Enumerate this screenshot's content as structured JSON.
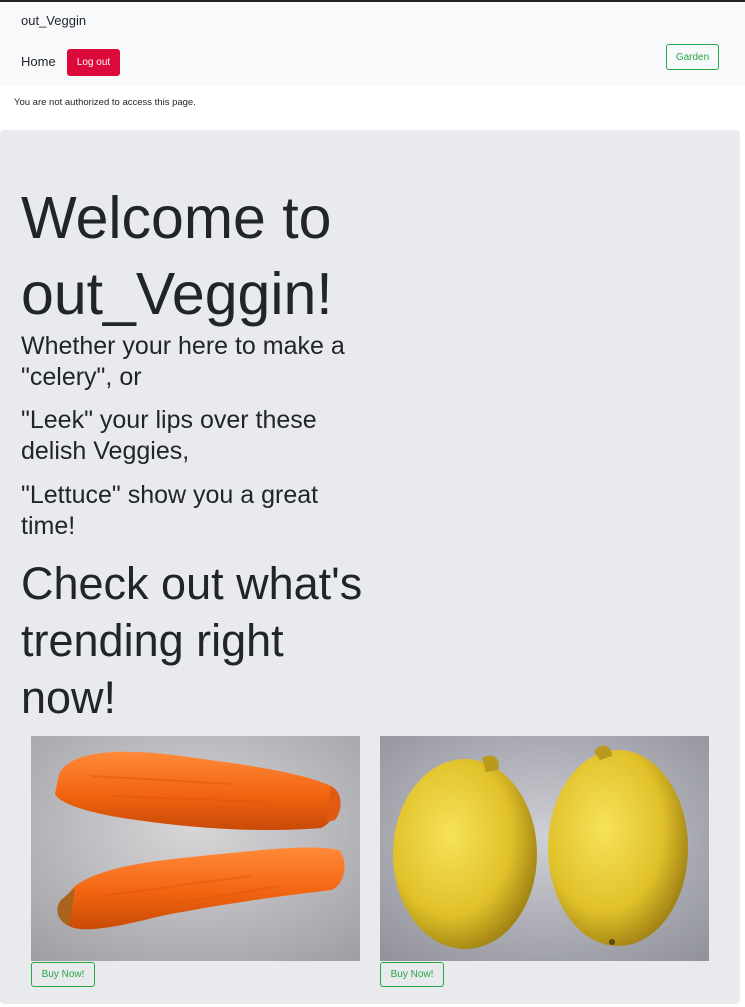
{
  "navbar": {
    "brand": "out_Veggin",
    "home_label": "Home",
    "logout_label": "Log out",
    "garden_label": "Garden"
  },
  "alert": {
    "message": "You are not authorized to access this page."
  },
  "hero": {
    "title": "Welcome to out_Veggin!",
    "lines": [
      "Whether your here to make a \"celery\", or",
      "\"Leek\" your lips over these delish Veggies,",
      "\"Lettuce\" show you a great time!"
    ],
    "trending_heading": "Check out what's trending right now!"
  },
  "products": [
    {
      "image": "carrots",
      "buy_label": "Buy Now!"
    },
    {
      "image": "lemons",
      "buy_label": "Buy Now!"
    }
  ],
  "colors": {
    "danger": "#dc0a3a",
    "success": "#28a745",
    "navbar_bg": "#f8f9fa",
    "jumbotron_bg": "#e9eaee"
  }
}
